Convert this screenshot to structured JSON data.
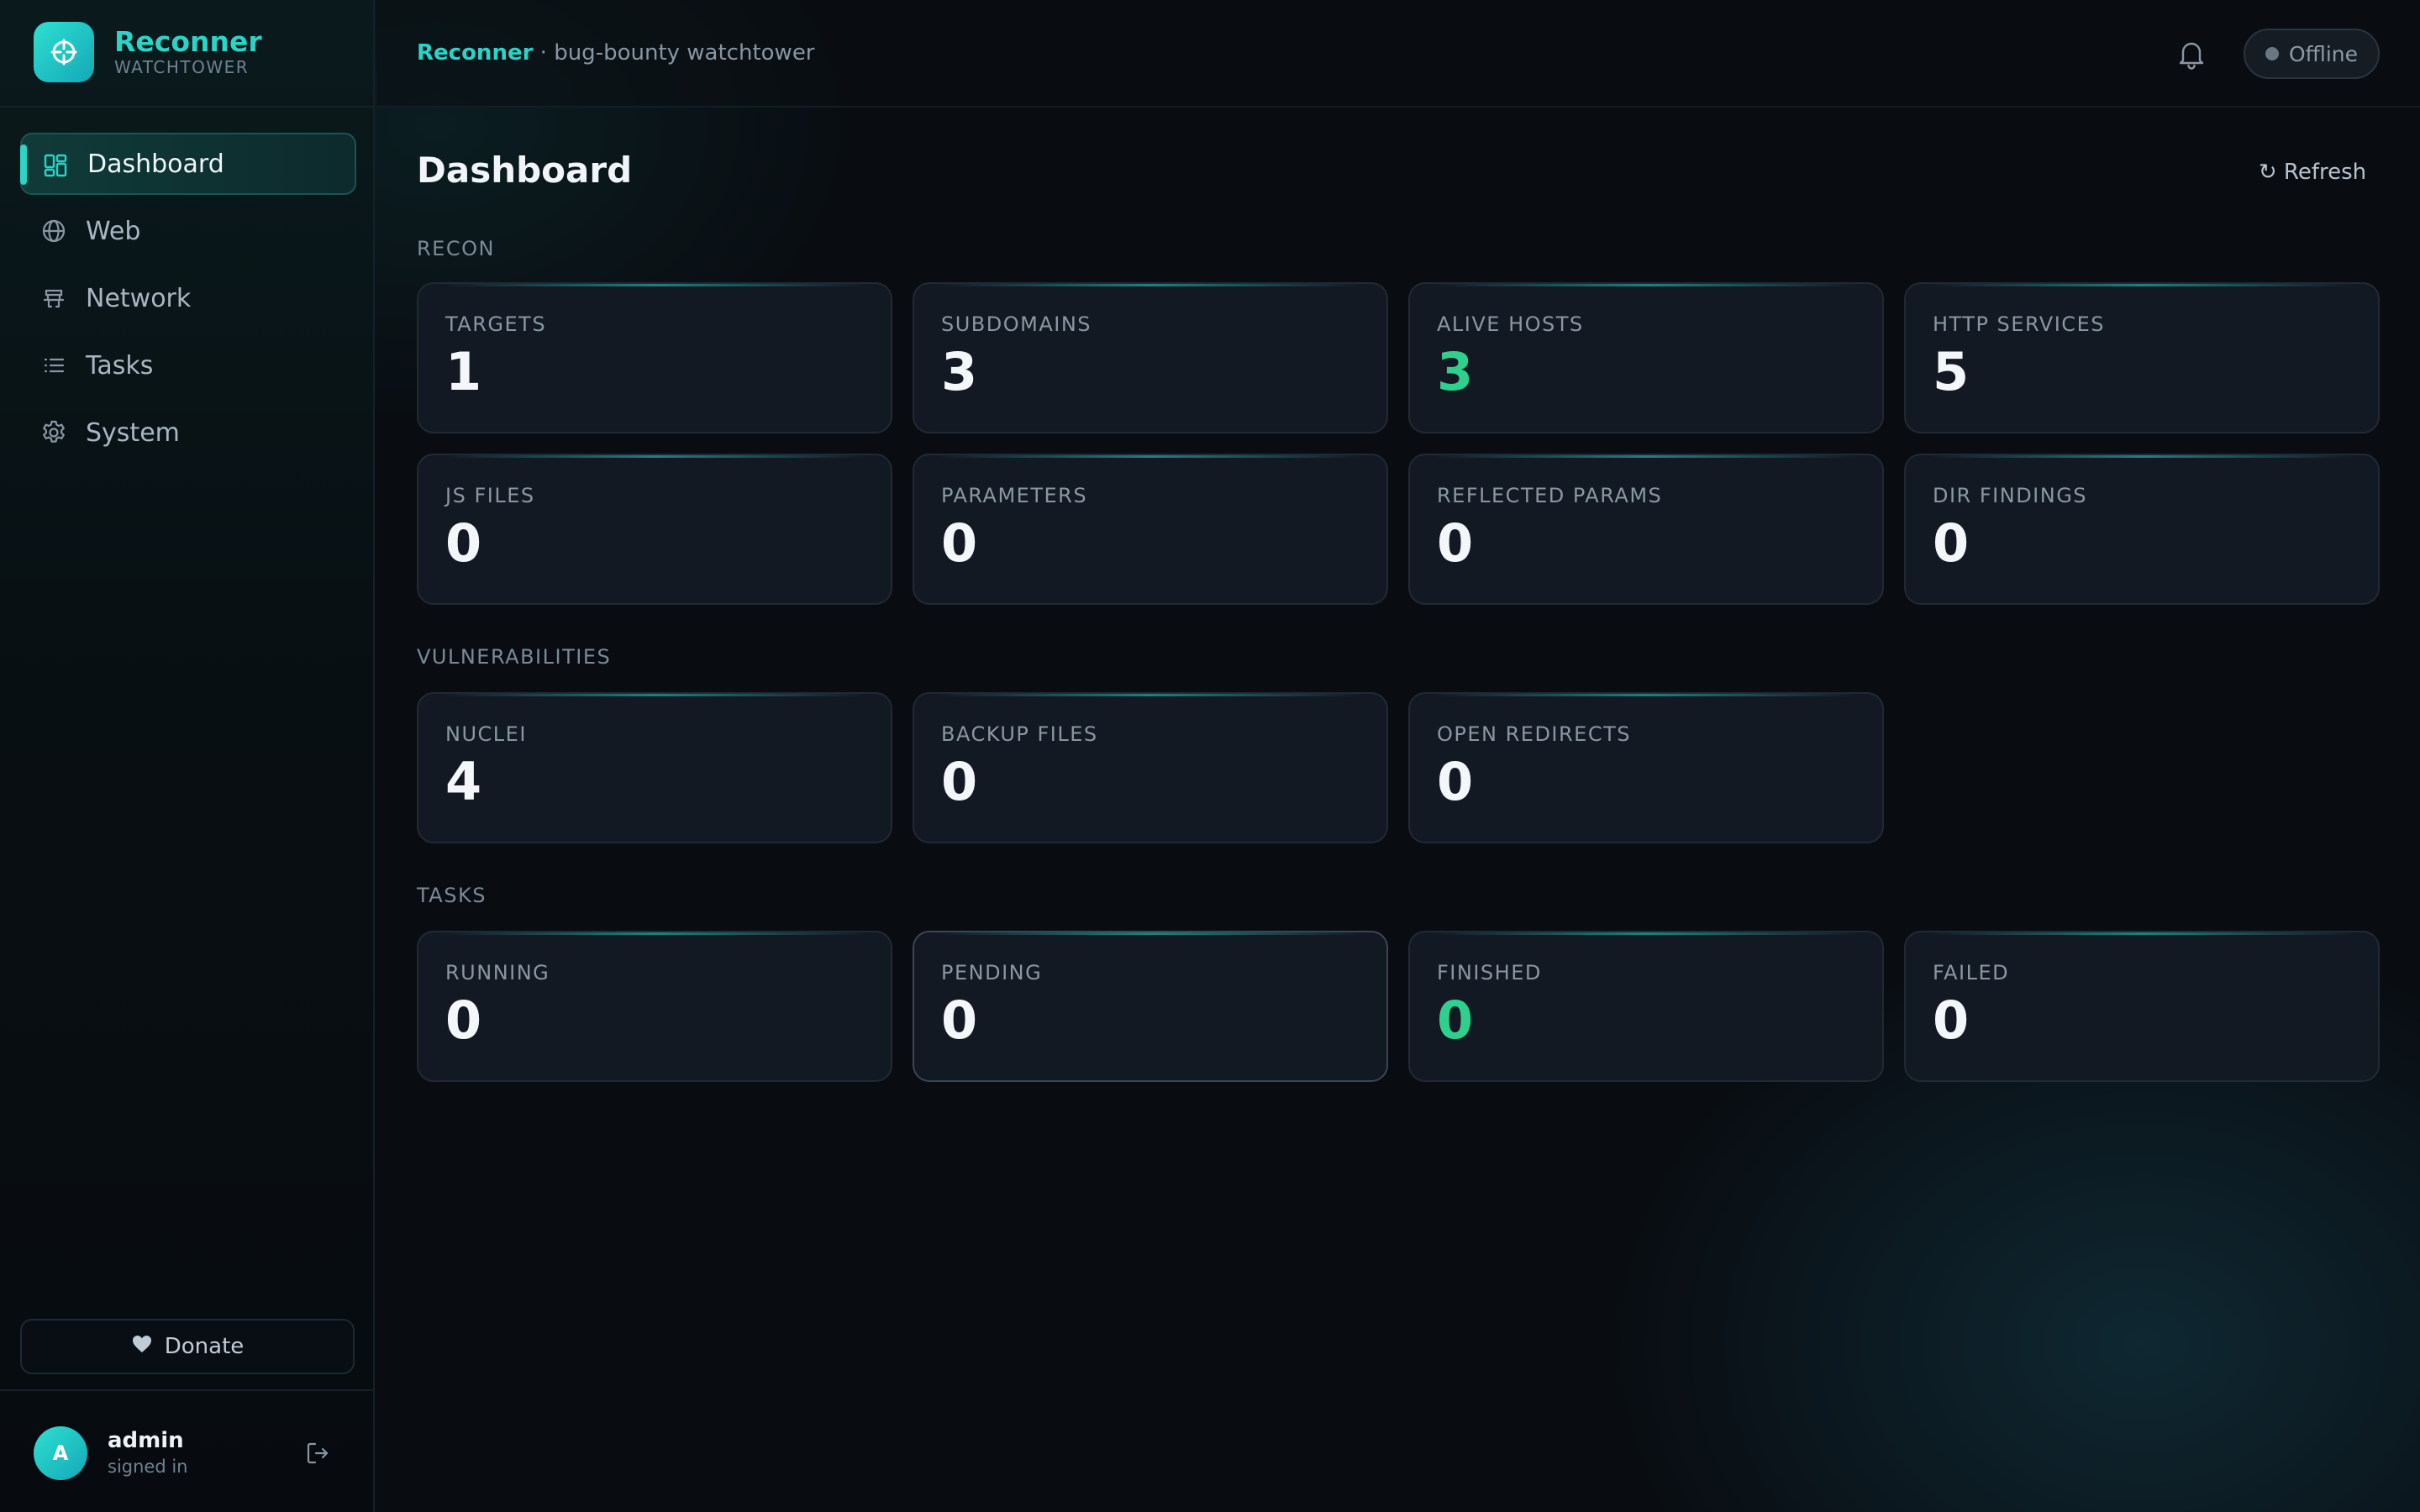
{
  "brand": {
    "name": "Reconner",
    "subtitle": "WATCHTOWER"
  },
  "sidebar": {
    "items": [
      {
        "label": "Dashboard",
        "icon": "dashboard-icon",
        "active": true
      },
      {
        "label": "Web",
        "icon": "globe-icon"
      },
      {
        "label": "Network",
        "icon": "network-icon"
      },
      {
        "label": "Tasks",
        "icon": "list-icon"
      },
      {
        "label": "System",
        "icon": "gear-icon"
      }
    ],
    "donate_label": "Donate",
    "user": {
      "avatar_letter": "A",
      "name": "admin",
      "status": "signed in"
    }
  },
  "header": {
    "app_name": "Reconner",
    "tagline": "· bug-bounty watchtower",
    "status": "Offline"
  },
  "main": {
    "title": "Dashboard",
    "refresh_label": "↻ Refresh",
    "sections": [
      {
        "title": "RECON",
        "cards": [
          {
            "label": "TARGETS",
            "value": "1"
          },
          {
            "label": "SUBDOMAINS",
            "value": "3"
          },
          {
            "label": "ALIVE HOSTS",
            "value": "3",
            "accent": "#2fd08e"
          },
          {
            "label": "HTTP SERVICES",
            "value": "5"
          },
          {
            "label": "JS FILES",
            "value": "0"
          },
          {
            "label": "PARAMETERS",
            "value": "0"
          },
          {
            "label": "REFLECTED PARAMS",
            "value": "0"
          },
          {
            "label": "DIR FINDINGS",
            "value": "0"
          }
        ]
      },
      {
        "title": "VULNERABILITIES",
        "cards": [
          {
            "label": "NUCLEI",
            "value": "4"
          },
          {
            "label": "BACKUP FILES",
            "value": "0"
          },
          {
            "label": "OPEN REDIRECTS",
            "value": "0"
          }
        ]
      },
      {
        "title": "TASKS",
        "cards": [
          {
            "label": "RUNNING",
            "value": "0"
          },
          {
            "label": "PENDING",
            "value": "0"
          },
          {
            "label": "FINISHED",
            "value": "0",
            "accent": "#2fd08e"
          },
          {
            "label": "FAILED",
            "value": "0"
          }
        ]
      }
    ]
  },
  "colors": {
    "accent": "#2ad4c8",
    "success": "#2fd08e",
    "background": "#090d12"
  }
}
